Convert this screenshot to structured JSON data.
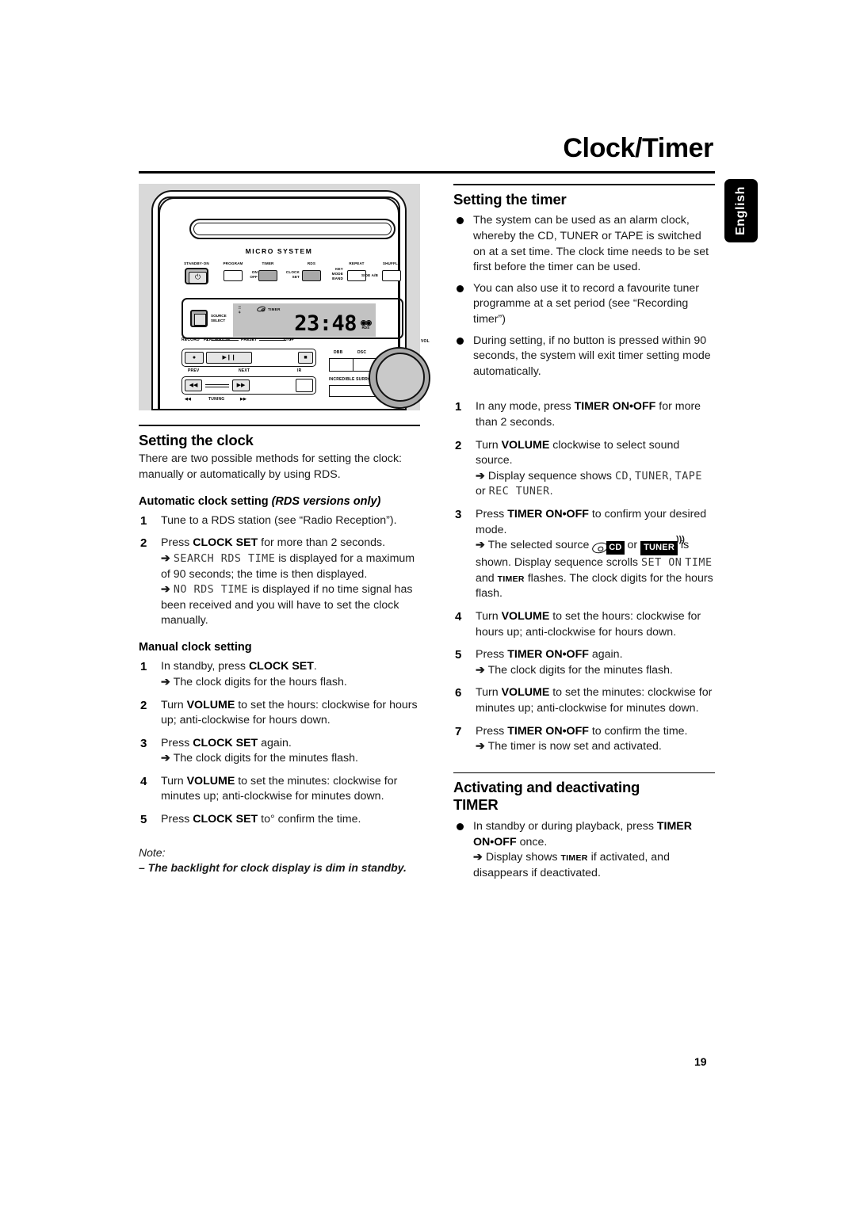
{
  "page": {
    "title": "Clock/Timer",
    "language_tab": "English",
    "page_number": "19"
  },
  "figure": {
    "brand": "MICRO SYSTEM",
    "buttons": [
      {
        "label": "STANDBY·ON",
        "kind": "power"
      },
      {
        "label": "PROGRAM",
        "kind": "plain"
      },
      {
        "label": "TIMER",
        "sublabel": "ON\nOFF",
        "kind": "gray"
      },
      {
        "label": "RDS",
        "sublabel": "CLOCK\nSET",
        "kind": "gray"
      },
      {
        "label": "REPEAT",
        "sublabel": "KEY\nMODE\nBAND",
        "kind": "plain"
      },
      {
        "label": "SHUFFLE",
        "sublabel": "SIDE A/B",
        "kind": "plain"
      }
    ],
    "source_select": "SOURCE\nSELECT",
    "lcd": {
      "time": "23:48",
      "timer_indicator": "TIMER",
      "cd_rds": "CD\nRDS"
    },
    "transport": {
      "record": "RECORD",
      "play_pause": "PLAY•PAUSE",
      "stop": "STOP",
      "preset": "PRESET",
      "prev": "PREV",
      "next": "NEXT",
      "ir": "IR",
      "tuning": "TUNING"
    },
    "dbb": "DBB",
    "dsc": "DSC",
    "incredible_surround": "INCREDIBLE SURROUND",
    "vol": "VOL"
  },
  "left_column": {
    "heading": "Setting the clock",
    "intro": "There are two possible methods for setting the clock: manually or automatically by using RDS.",
    "auto_heading_plain": "Automatic clock setting ",
    "auto_heading_italic": "(RDS versions only)",
    "auto_steps": [
      {
        "num": "1",
        "text": "Tune to a RDS station (see “Radio Reception”)."
      },
      {
        "num": "2",
        "text_pre": "Press ",
        "bold": "CLOCK SET",
        "text_post": " for more than 2 seconds.",
        "arrow1_seg": "SEARCH RDS TIME",
        "arrow1_rest": " is displayed for a maximum of 90 seconds; the time is then displayed.",
        "arrow2_seg": "NO RDS TIME",
        "arrow2_rest": " is displayed if no time signal has been received and you will have to set the clock manually."
      }
    ],
    "manual_heading": "Manual clock setting",
    "manual_steps": [
      {
        "num": "1",
        "text_pre": "In standby, press ",
        "bold": "CLOCK SET",
        "text_post": ".",
        "arrow": "The clock digits for the hours flash."
      },
      {
        "num": "2",
        "text_pre": "Turn ",
        "bold": "VOLUME",
        "text_post": " to set the hours: clockwise for hours up; anti-clockwise for hours down."
      },
      {
        "num": "3",
        "text_pre": "Press ",
        "bold": "CLOCK SET",
        "text_post": " again.",
        "arrow": "The clock digits for the minutes flash."
      },
      {
        "num": "4",
        "text_pre": "Turn ",
        "bold": "VOLUME",
        "text_post": " to set the minutes: clockwise for minutes up; anti-clockwise for minutes down."
      },
      {
        "num": "5",
        "text_pre": "Press ",
        "bold": "CLOCK SET",
        "text_post": " to° confirm the time."
      }
    ],
    "note_label": "Note:",
    "note_body": "–  The backlight for clock display is dim in standby."
  },
  "right_column": {
    "timer_heading": "Setting the timer",
    "timer_bullets": [
      "The system can be used as an alarm clock, whereby the CD, TUNER or TAPE is switched on at a set time. The clock time needs to be set first before the timer can be used.",
      "You can also use it to record a favourite tuner programme at a set period (see “Recording timer”)",
      "During setting, if no button is pressed within 90 seconds, the system will exit timer setting mode automatically."
    ],
    "timer_steps": [
      {
        "num": "1",
        "text_pre": "In any mode, press ",
        "bold": "TIMER ON•OFF",
        "text_post": " for more than 2 seconds."
      },
      {
        "num": "2",
        "text_pre": "Turn ",
        "bold": "VOLUME",
        "text_post": " clockwise to select sound source.",
        "arrow_pre": "Display sequence shows ",
        "arrow_seg1": "CD",
        "arrow_mid1": ", ",
        "arrow_seg2": "TUNER",
        "arrow_mid2": ", ",
        "arrow_seg3": "TAPE",
        "arrow_mid3": " or ",
        "arrow_seg4": "REC TUNER",
        "arrow_end": "."
      },
      {
        "num": "3",
        "text_pre": "Press ",
        "bold": "TIMER ON•OFF",
        "text_post": " to confirm your desired mode.",
        "arrow_pre": "The selected source ",
        "icon_cd": "CD",
        "arrow_or": " or ",
        "icon_tuner": "TUNER",
        "arrow_mid": " is shown. Display sequence scrolls ",
        "seg_set_on": "SET ON",
        "seg_time": "TIME",
        "arrow_and": " and ",
        "badge_timer": "TIMER",
        "arrow_end": " flashes. The clock digits for the hours flash."
      },
      {
        "num": "4",
        "text_pre": "Turn ",
        "bold": "VOLUME",
        "text_post": " to set the hours: clockwise for hours up; anti-clockwise for hours down."
      },
      {
        "num": "5",
        "text_pre": "Press ",
        "bold": "TIMER ON•OFF",
        "text_post": " again.",
        "arrow": "The clock digits for the minutes flash."
      },
      {
        "num": "6",
        "text_pre": "Turn ",
        "bold": "VOLUME",
        "text_post": " to set the minutes: clockwise for minutes up; anti-clockwise for minutes down."
      },
      {
        "num": "7",
        "text_pre": "Press ",
        "bold": "TIMER ON•OFF",
        "text_post": " to confirm the time.",
        "arrow": "The timer is now set and activated."
      }
    ],
    "activating_heading_line1": "Activating and deactivating",
    "activating_heading_line2": "TIMER",
    "activating_bullet": {
      "text_pre": "In standby or during playback, press ",
      "bold": "TIMER ON•OFF",
      "text_post": " once.",
      "arrow_pre": "Display shows ",
      "badge": "TIMER",
      "arrow_post": " if activated, and disappears if deactivated."
    }
  }
}
